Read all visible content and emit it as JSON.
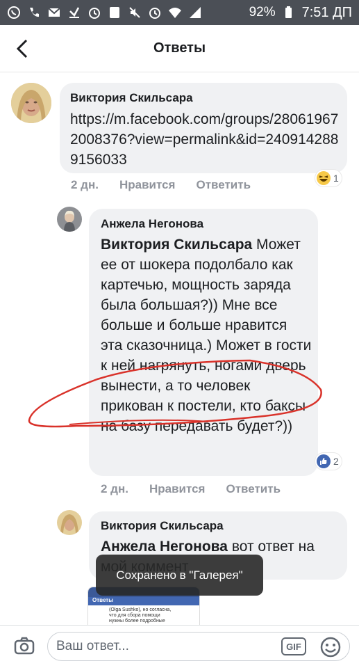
{
  "status_bar": {
    "battery_percent": "92%",
    "time": "7:51 ДП",
    "icons": [
      "whatsapp-icon",
      "phone-icon",
      "gmail-icon",
      "download-icon",
      "alarm-icon",
      "image-icon",
      "mute-icon",
      "alarm-icon",
      "wifi-icon",
      "signal-icon",
      "battery-icon"
    ]
  },
  "header": {
    "title": "Ответы",
    "back_icon": "chevron-left-icon"
  },
  "comments": [
    {
      "author": "Виктория Скильсара",
      "text": "https://m.facebook.com/groups/280619672008376?view=permalink&id=2409142889156033",
      "time": "2 дн.",
      "like_label": "Нравится",
      "reply_label": "Ответить",
      "reaction": {
        "icon": "haha-icon",
        "count": "1"
      }
    },
    {
      "author": "Анжела Негонова",
      "mention": "Виктория Скильсара",
      "text": "Может ее от шокера подолбало как картечью, мощность заряда была большая?)) Мне все больше и больше нравится эта сказочница.) Может в гости к ней нагрянуть, ногами дверь вынести, а то человек прикован к постели, кто баксы на базу передавать будет?))",
      "time": "2 дн.",
      "like_label": "Нравится",
      "reply_label": "Ответить",
      "reaction": {
        "icon": "like-icon",
        "count": "2"
      }
    },
    {
      "author": "Виктория Скильсара",
      "mention": "Анжела Негонова",
      "text": "вот ответ на мой коммент"
    }
  ],
  "toast": {
    "text": "Сохранено в \"Галерея\""
  },
  "preview": {
    "header": "Ответы",
    "lines": [
      "(Olga Sushko), но согласна,",
      "что для сбора помощи",
      "нужны более подробные"
    ]
  },
  "composer": {
    "placeholder": "Ваш ответ...",
    "gif_label": "GIF",
    "camera_icon": "camera-icon",
    "emoji_icon": "emoji-icon"
  },
  "colors": {
    "status_bar": "#4b4f56",
    "bubble": "#f0f1f3",
    "meta_text": "#90949c",
    "like_blue": "#4267b2",
    "annotation_red": "#d9322a"
  }
}
